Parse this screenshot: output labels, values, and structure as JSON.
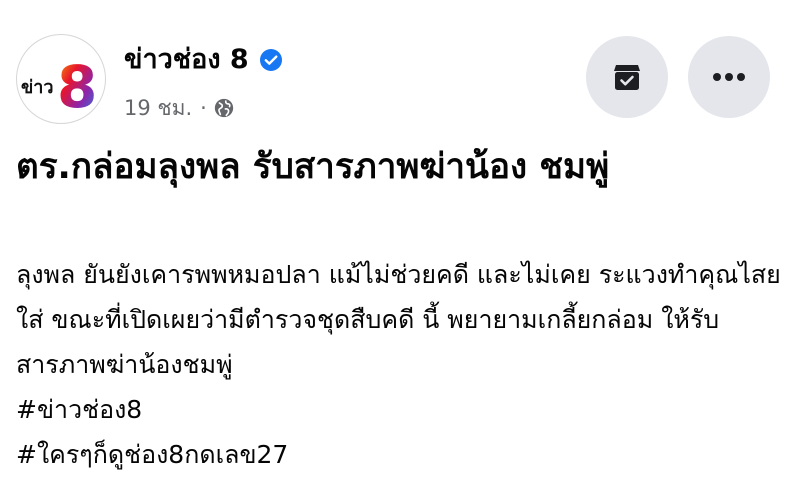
{
  "post": {
    "page_name": "ข่าวช่อง 8",
    "time_ago": "19 ชม.",
    "separator": "·",
    "avatar_text": "ข่าว",
    "avatar_number": "8",
    "headline": "ตร.กล่อมลุงพล รับสารภาพฆ่าน้อง ชมพู่",
    "body": "ลุงพล ยันยังเคารพพหมอปลา แม้ไม่ช่วยคดี และไม่เคย ระแวงทำคุณไสยใส่ ขณะที่เปิดเผยว่ามีตำรวจชุดสืบคดี นี้ พยายามเกลี้ยกล่อม ให้รับสารภาพฆ่าน้องชมพู่",
    "hashtags": [
      "#ข่าวช่อง8",
      "#ใครๆก็ดูช่อง8กดเลข27"
    ]
  },
  "icons": {
    "verified": "verified-badge-icon",
    "audience": "globe-icon",
    "archive": "archive-icon",
    "more": "more-options-icon"
  },
  "colors": {
    "verified_blue": "#1877f2",
    "secondary_text": "#65676b",
    "button_bg": "#e4e6eb",
    "text": "#050505"
  }
}
